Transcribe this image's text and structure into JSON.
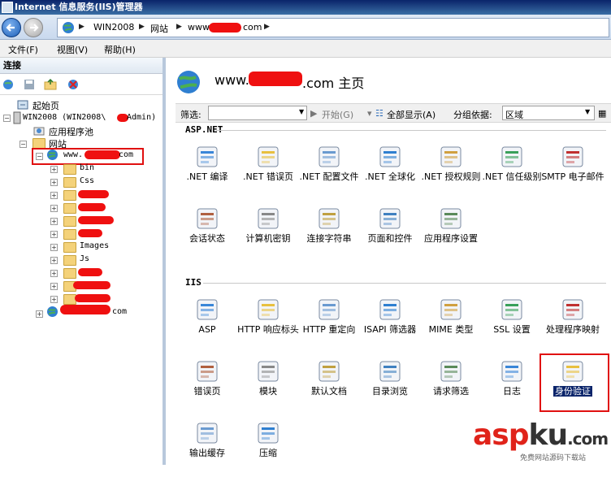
{
  "window": {
    "title": "Internet 信息服务(IIS)管理器"
  },
  "address": {
    "crumbs": [
      "WIN2008",
      "网站",
      "www.",
      "com"
    ]
  },
  "menu": {
    "file": "文件(F)",
    "view": "视图(V)",
    "help": "帮助(H)"
  },
  "left": {
    "header": "连接",
    "tree": {
      "start": "起始页",
      "server": "WIN2008 (WIN2008\\",
      "server_suffix": "Admin)",
      "apppool": "应用程序池",
      "sites": "网站",
      "site1_prefix": "www.",
      "site1_suffix": "com",
      "folders": [
        "bin",
        "Css",
        "Images",
        "Js"
      ],
      "site2_suffix": "com"
    }
  },
  "right": {
    "title_prefix": "www.",
    "title_suffix": ".com 主页",
    "filter": {
      "label": "筛选:",
      "start": "开始(G)",
      "show_all": "全部显示(A)",
      "group_by": "分组依据:",
      "group_value": "区域"
    },
    "sections": {
      "aspnet": "ASP.NET",
      "iis": "IIS"
    },
    "aspnet_tiles": [
      ".NET 编译",
      ".NET 错误页",
      ".NET 配置文件",
      ".NET 全球化",
      ".NET 授权规则",
      ".NET 信任级别",
      "SMTP 电子邮件",
      "会话状态",
      "计算机密钥",
      "连接字符串",
      "页面和控件",
      "应用程序设置"
    ],
    "iis_tiles": [
      "ASP",
      "HTTP 响应标头",
      "HTTP 重定向",
      "ISAPI 筛选器",
      "MIME 类型",
      "SSL 设置",
      "处理程序映射",
      "错误页",
      "模块",
      "默认文档",
      "目录浏览",
      "请求筛选",
      "日志",
      "身份验证",
      "输出缓存",
      "压缩"
    ]
  },
  "watermark": {
    "brand_a": "asp",
    "brand_b": "ku",
    "tail": ".com",
    "sub": "免费网站源码下载站"
  },
  "colors": {
    "highlight": "#e01010",
    "titlebar": "#0a246a"
  }
}
